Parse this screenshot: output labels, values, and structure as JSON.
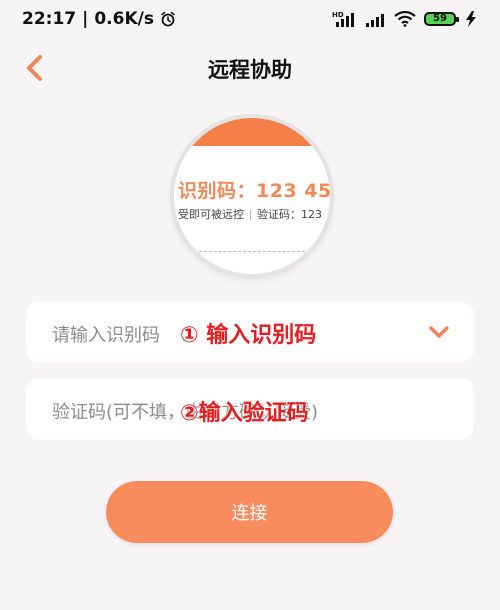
{
  "status_bar": {
    "time": "22:17",
    "speed": "0.6K/s",
    "battery": "59",
    "hd_label": "HD"
  },
  "nav": {
    "title": "远程协助"
  },
  "illustration": {
    "code_text": "识别码：123 45",
    "sub_left": "受即可被远控",
    "sub_right": "验证码：123"
  },
  "form": {
    "id_field_placeholder": "请输入识别码",
    "code_field_placeholder": "验证码(可不填，由对方确认接受)"
  },
  "annotations": {
    "step1": "① 输入识别码",
    "step2": "②输入验证码"
  },
  "actions": {
    "connect_label": "连接"
  },
  "colors": {
    "accent": "#f88c5c",
    "annotation": "#e41e1e"
  }
}
